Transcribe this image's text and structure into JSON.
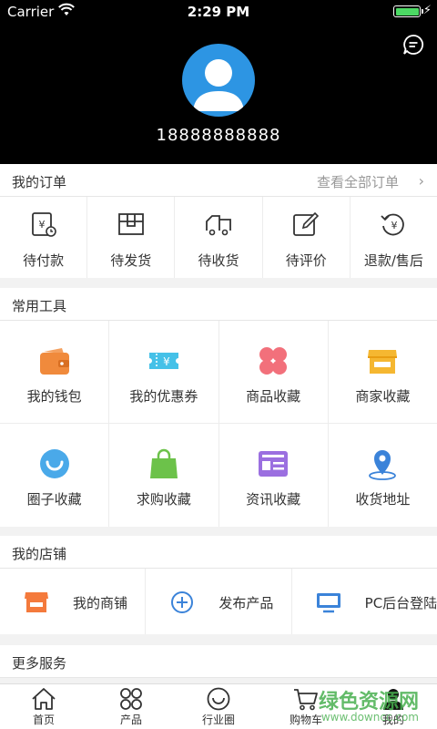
{
  "status_bar": {
    "carrier": "Carrier",
    "time": "2:29 PM"
  },
  "profile": {
    "phone": "18888888888"
  },
  "orders_section": {
    "title": "我的订单",
    "view_all": "查看全部订单",
    "items": [
      {
        "label": "待付款",
        "icon": "pending-payment-icon"
      },
      {
        "label": "待发货",
        "icon": "pending-shipment-icon"
      },
      {
        "label": "待收货",
        "icon": "pending-receipt-icon"
      },
      {
        "label": "待评价",
        "icon": "pending-review-icon"
      },
      {
        "label": "退款/售后",
        "icon": "refund-icon"
      }
    ]
  },
  "tools_section": {
    "title": "常用工具",
    "items": [
      {
        "label": "我的钱包",
        "icon": "wallet-icon",
        "color": "#f08a3c"
      },
      {
        "label": "我的优惠券",
        "icon": "coupon-icon",
        "color": "#45c1e8"
      },
      {
        "label": "商品收藏",
        "icon": "clover-icon",
        "color": "#f2707b"
      },
      {
        "label": "商家收藏",
        "icon": "storefront-icon",
        "color": "#f5b731"
      },
      {
        "label": "圈子收藏",
        "icon": "smile-circle-icon",
        "color": "#4aa9e9"
      },
      {
        "label": "求购收藏",
        "icon": "shopping-bag-icon",
        "color": "#6cc24a"
      },
      {
        "label": "资讯收藏",
        "icon": "news-icon",
        "color": "#9b6fe0"
      },
      {
        "label": "收货地址",
        "icon": "location-pin-icon",
        "color": "#3b83d9"
      }
    ]
  },
  "shop_section": {
    "title": "我的店铺",
    "items": [
      {
        "label": "我的商铺",
        "icon": "shop-icon"
      },
      {
        "label": "发布产品",
        "icon": "add-circle-icon"
      },
      {
        "label": "PC后台登陆",
        "icon": "monitor-icon"
      }
    ]
  },
  "more_section": {
    "title": "更多服务"
  },
  "tabbar": {
    "items": [
      {
        "label": "首页",
        "icon": "home-icon"
      },
      {
        "label": "产品",
        "icon": "grid-icon"
      },
      {
        "label": "行业圈",
        "icon": "circle-icon"
      },
      {
        "label": "购物车",
        "icon": "cart-icon"
      },
      {
        "label": "我的",
        "icon": "user-icon"
      }
    ]
  },
  "watermark": {
    "big": "绿色资源网",
    "small": "www.downcc.com"
  }
}
